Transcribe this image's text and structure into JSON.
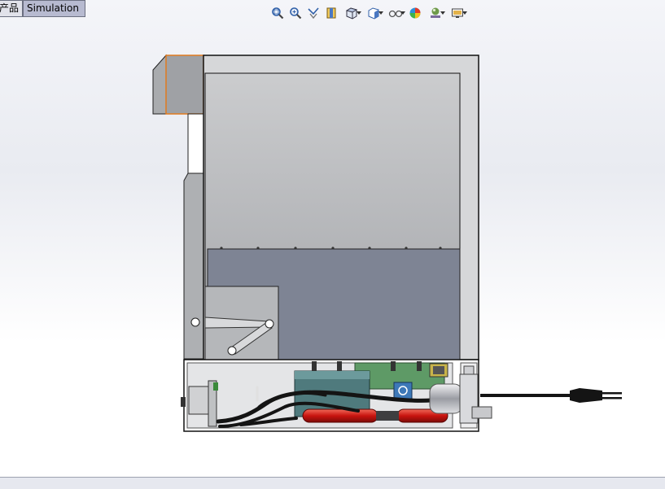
{
  "tabs": [
    {
      "label": "产品",
      "state": "partial"
    },
    {
      "label": "Simulation",
      "state": "active"
    }
  ],
  "toolbar": {
    "tools": [
      {
        "icon": "zoom-to-fit-icon",
        "dropdown": false
      },
      {
        "icon": "zoom-to-area-icon",
        "dropdown": false
      },
      {
        "icon": "previous-view-icon",
        "dropdown": false
      },
      {
        "icon": "section-view-icon",
        "dropdown": false
      },
      {
        "icon": "view-orientation-icon",
        "dropdown": true
      },
      {
        "icon": "display-style-icon",
        "dropdown": true
      },
      {
        "icon": "hide-show-items-icon",
        "dropdown": true
      },
      {
        "icon": "edit-appearance-icon",
        "dropdown": false
      },
      {
        "icon": "apply-scene-icon",
        "dropdown": true
      },
      {
        "icon": "view-settings-icon",
        "dropdown": true
      }
    ]
  },
  "colors": {
    "accent_orange": "#e07a1f",
    "cabinet_gray": "#babcbf",
    "panel_blue_gray": "#7e8494",
    "heater_red": "#d4201c",
    "cable_black": "#141414"
  }
}
